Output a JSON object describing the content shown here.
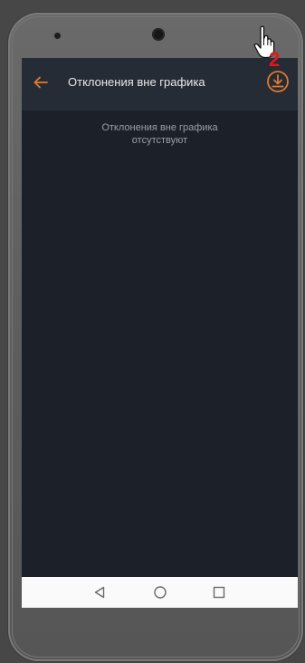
{
  "appbar": {
    "title": "Отклонения вне графика",
    "back_icon": "arrow-left-icon",
    "action_icon": "download-star-icon"
  },
  "annotation": {
    "step_number": "2",
    "cursor_icon": "pointing-hand-icon"
  },
  "content": {
    "empty_message": "Отклонения вне графика\nотсутствуют"
  },
  "navbar": {
    "back_icon": "triangle-back-icon",
    "home_icon": "circle-home-icon",
    "recents_icon": "square-recents-icon"
  },
  "colors": {
    "accent": "#e07a2a",
    "appbar_bg": "#262c36",
    "screen_bg": "#1b2029",
    "title_text": "#e8e8e8",
    "empty_text": "#9aa0a8",
    "step_number": "#e8141b",
    "navbar_bg": "#fafafa"
  }
}
